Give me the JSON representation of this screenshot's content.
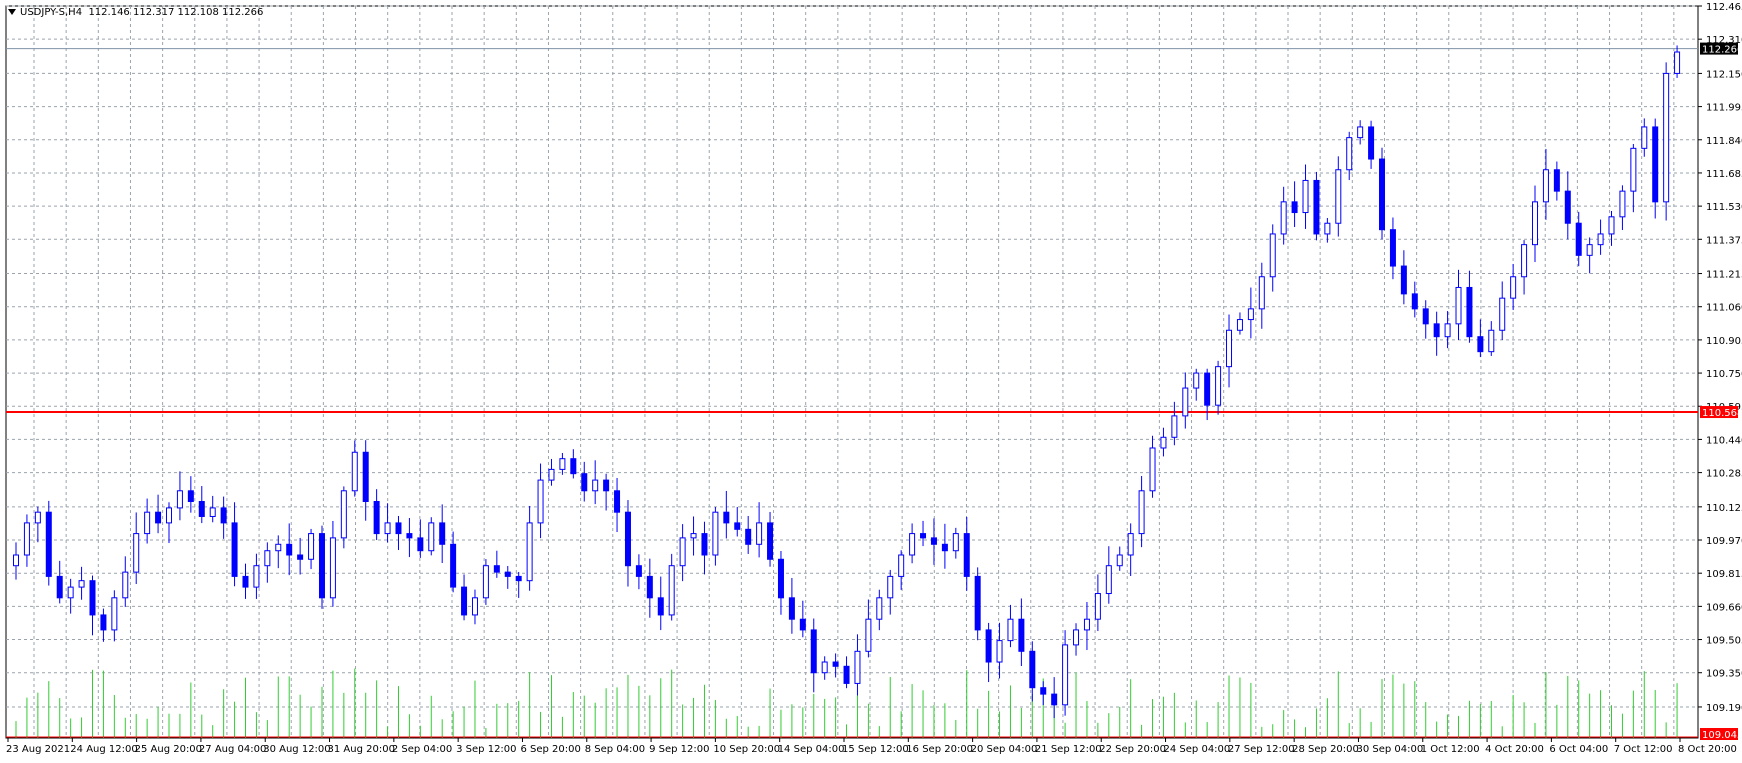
{
  "header": {
    "symbol": "USDJPY-S,H4",
    "ohlc": "112.146 112.317 112.108 112.266"
  },
  "colors": {
    "up": "#1a1aa8",
    "down": "#0000ff",
    "grid": "#9aa3ad",
    "volume": "#33cc33",
    "level": "#ff0000",
    "price": "#000000"
  },
  "chart_data": {
    "type": "candlestick",
    "ylim": [
      109.045,
      112.465
    ],
    "y_ticks": [
      "112.465",
      "112.310",
      "112.150",
      "111.995",
      "111.840",
      "111.685",
      "111.530",
      "111.375",
      "111.215",
      "111.060",
      "110.905",
      "110.750",
      "110.595",
      "110.440",
      "110.285",
      "110.125",
      "109.970",
      "109.815",
      "109.660",
      "109.505",
      "109.350",
      "109.190"
    ],
    "x_labels": [
      "23 Aug 2021",
      "24 Aug 12:00",
      "25 Aug 20:00",
      "27 Aug 04:00",
      "30 Aug 12:00",
      "31 Aug 20:00",
      "2 Sep 04:00",
      "3 Sep 12:00",
      "6 Sep 20:00",
      "8 Sep 04:00",
      "9 Sep 12:00",
      "10 Sep 20:00",
      "14 Sep 04:00",
      "15 Sep 12:00",
      "16 Sep 20:00",
      "20 Sep 04:00",
      "21 Sep 12:00",
      "22 Sep 20:00",
      "24 Sep 04:00",
      "27 Sep 12:00",
      "28 Sep 20:00",
      "30 Sep 04:00",
      "1 Oct 12:00",
      "4 Oct 20:00",
      "6 Oct 04:00",
      "7 Oct 12:00",
      "8 Oct 20:00"
    ],
    "current_price": "112.266",
    "level_price": "110.568",
    "bottom_price": "109.045",
    "closes": [
      109.9,
      110.05,
      110.1,
      109.8,
      109.7,
      109.75,
      109.78,
      109.62,
      109.55,
      109.7,
      109.82,
      110.0,
      110.1,
      110.05,
      110.12,
      110.2,
      110.15,
      110.08,
      110.12,
      110.05,
      109.8,
      109.75,
      109.85,
      109.92,
      109.95,
      109.9,
      109.88,
      110.0,
      109.7,
      109.98,
      110.2,
      110.38,
      110.15,
      110.0,
      110.05,
      110.0,
      109.98,
      109.92,
      110.05,
      109.95,
      109.75,
      109.62,
      109.7,
      109.85,
      109.82,
      109.8,
      109.78,
      110.05,
      110.25,
      110.3,
      110.35,
      110.28,
      110.2,
      110.25,
      110.2,
      110.1,
      109.85,
      109.8,
      109.7,
      109.62,
      109.85,
      109.98,
      110.0,
      109.9,
      110.1,
      110.05,
      110.02,
      109.95,
      110.05,
      109.88,
      109.7,
      109.6,
      109.55,
      109.35,
      109.4,
      109.38,
      109.3,
      109.45,
      109.6,
      109.7,
      109.8,
      109.9,
      110.0,
      109.98,
      109.95,
      109.92,
      110.0,
      109.8,
      109.55,
      109.4,
      109.5,
      109.6,
      109.45,
      109.28,
      109.25,
      109.2,
      109.48,
      109.55,
      109.6,
      109.72,
      109.85,
      109.9,
      110.0,
      110.2,
      110.4,
      110.45,
      110.55,
      110.68,
      110.75,
      110.6,
      110.78,
      110.95,
      111.0,
      111.05,
      111.2,
      111.4,
      111.55,
      111.5,
      111.65,
      111.4,
      111.45,
      111.7,
      111.85,
      111.9,
      111.75,
      111.42,
      111.25,
      111.12,
      111.05,
      110.98,
      110.92,
      110.98,
      111.15,
      110.92,
      110.85,
      110.95,
      111.1,
      111.2,
      111.35,
      111.55,
      111.7,
      111.6,
      111.45,
      111.3,
      111.35,
      111.4,
      111.48,
      111.6,
      111.8,
      111.9,
      111.55,
      112.15,
      112.25
    ]
  }
}
